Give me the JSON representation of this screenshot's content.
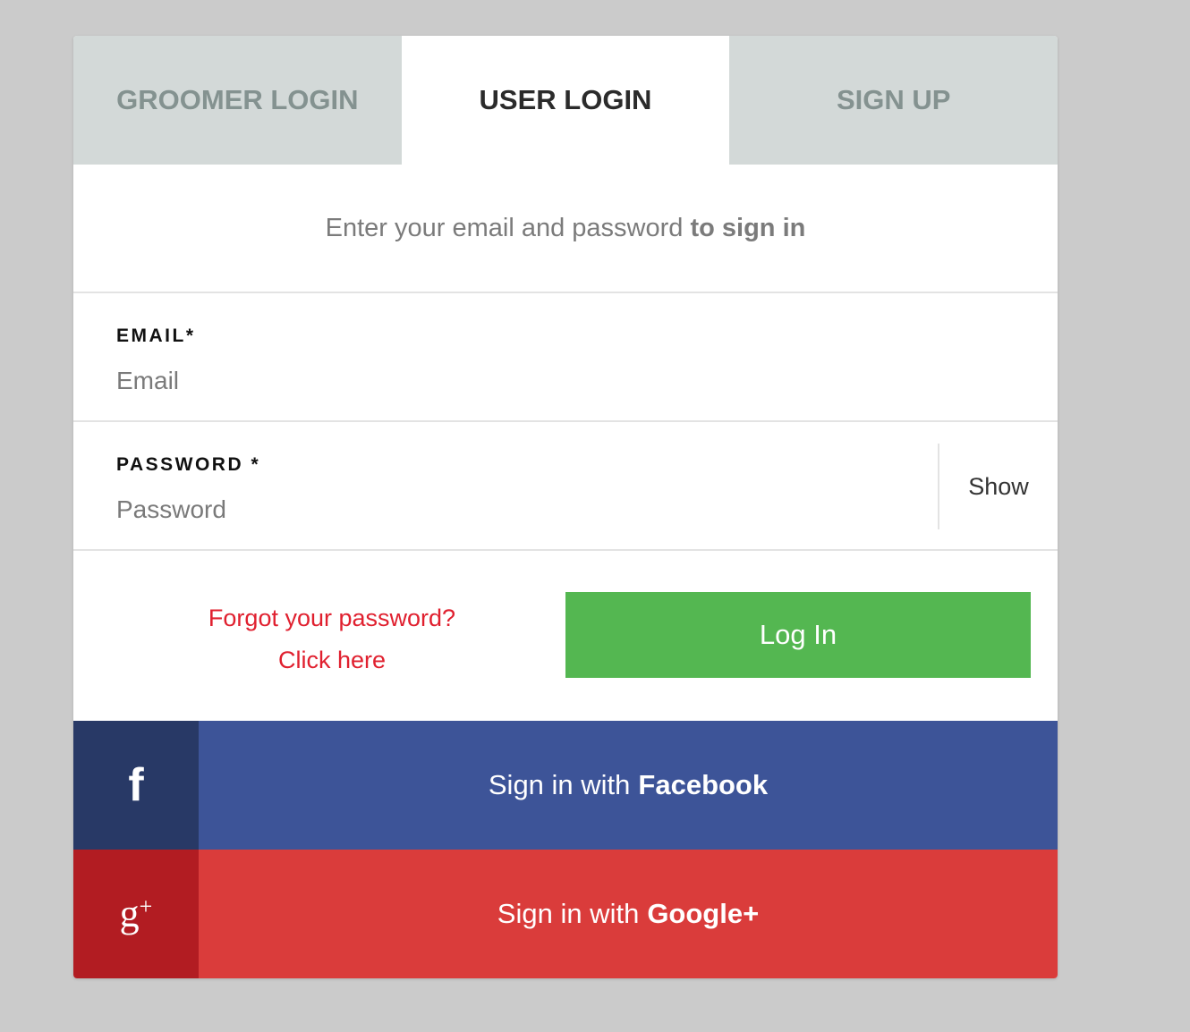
{
  "tabs": [
    {
      "label": "GROOMER LOGIN",
      "active": false
    },
    {
      "label": "USER LOGIN",
      "active": true
    },
    {
      "label": "SIGN UP",
      "active": false
    }
  ],
  "intro": {
    "text": "Enter your email and password",
    "bold": "to sign in"
  },
  "email": {
    "label": "EMAIL*",
    "placeholder": "Email",
    "value": ""
  },
  "password": {
    "label": "PASSWORD *",
    "placeholder": "Password",
    "value": "",
    "show_label": "Show"
  },
  "forgot": {
    "line1": "Forgot your password?",
    "line2": "Click here"
  },
  "login_button": "Log In",
  "facebook": {
    "prefix": "Sign in with",
    "brand": "Facebook",
    "icon": "facebook-icon"
  },
  "google": {
    "prefix": "Sign in with",
    "brand": "Google+",
    "icon": "google-plus-icon"
  },
  "colors": {
    "background": "#cbcbcb",
    "tab_inactive_bg": "#d3d9d8",
    "tab_inactive_text": "#849290",
    "login_green": "#54b751",
    "forgot_red": "#e0202f",
    "facebook_dark": "#283966",
    "facebook": "#3d5498",
    "google_dark": "#b21c22",
    "google": "#da3c3b"
  }
}
